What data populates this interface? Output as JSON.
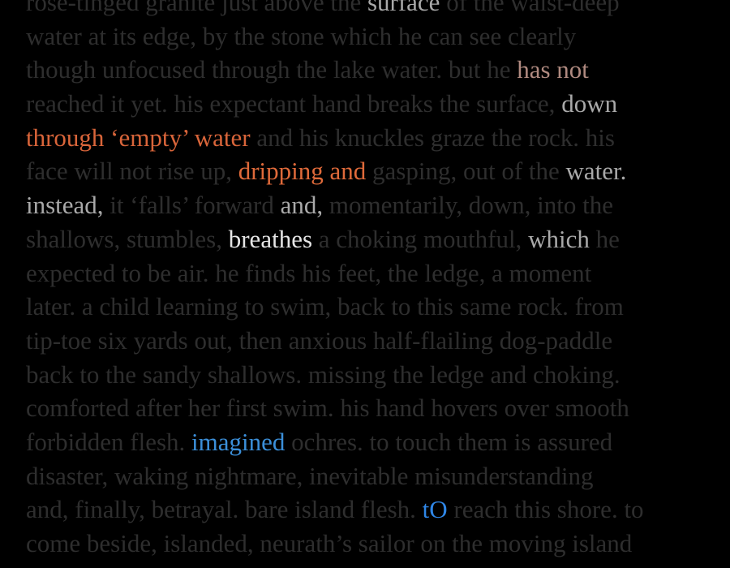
{
  "text": {
    "l0a": "rose-tinged granite just above the ",
    "l0b": "surface",
    "l0c": " of the waist-deep",
    "l1": "water at its edge, by the stone which he can see clearly",
    "l2a": "though unfocused through the lake water. but he ",
    "l2b": "has not",
    "l3a": "reached it yet. his expectant hand breaks the surface, ",
    "l3b": "down",
    "l4a": "through ‘empty’ water",
    "l4b": " and his knuckles graze the rock. his",
    "l5a": "face will not rise up, ",
    "l5b": "dripping and",
    "l5c": " gasping, out of the ",
    "l5d": "water.",
    "l6a": "instead,",
    "l6b": " it ‘falls’ forward ",
    "l6c": "and,",
    "l6d": " momentarily, down, into the",
    "l7a": "shallows, stumbles, ",
    "l7b": "breathes",
    "l7c": " a choking mouthful, ",
    "l7d": "which",
    "l7e": " he",
    "l8": "expected to be air. he finds his feet, the ledge, a moment",
    "l9": "later. a child learning to swim, back to this same rock. from",
    "l10": "tip-toe six yards out, then anxious half-flailing dog-paddle",
    "l11": "back to the sandy shallows. missing the ledge and choking.",
    "l12": "comforted after her first swim. his hand hovers over smooth",
    "l13a": "forbidden flesh. ",
    "l13b": "imagined",
    "l13c": " ochres. to touch them is assured",
    "l14": "disaster, waking nightmare, inevitable misunderstanding",
    "l15a": "and, finally, betrayal. bare island flesh. ",
    "l15b": "tO",
    "l15c": " reach this shore. to",
    "l16": "come beside, islanded, neurath’s sailor on the moving island"
  },
  "colors": {
    "background": "#000000",
    "dim_text": "#2e2e2e",
    "highlight_orange": "#d9653a",
    "highlight_blue": "#3b8fd9",
    "highlight_white": "#e6e6e6",
    "highlight_rose": "#b08a80"
  }
}
